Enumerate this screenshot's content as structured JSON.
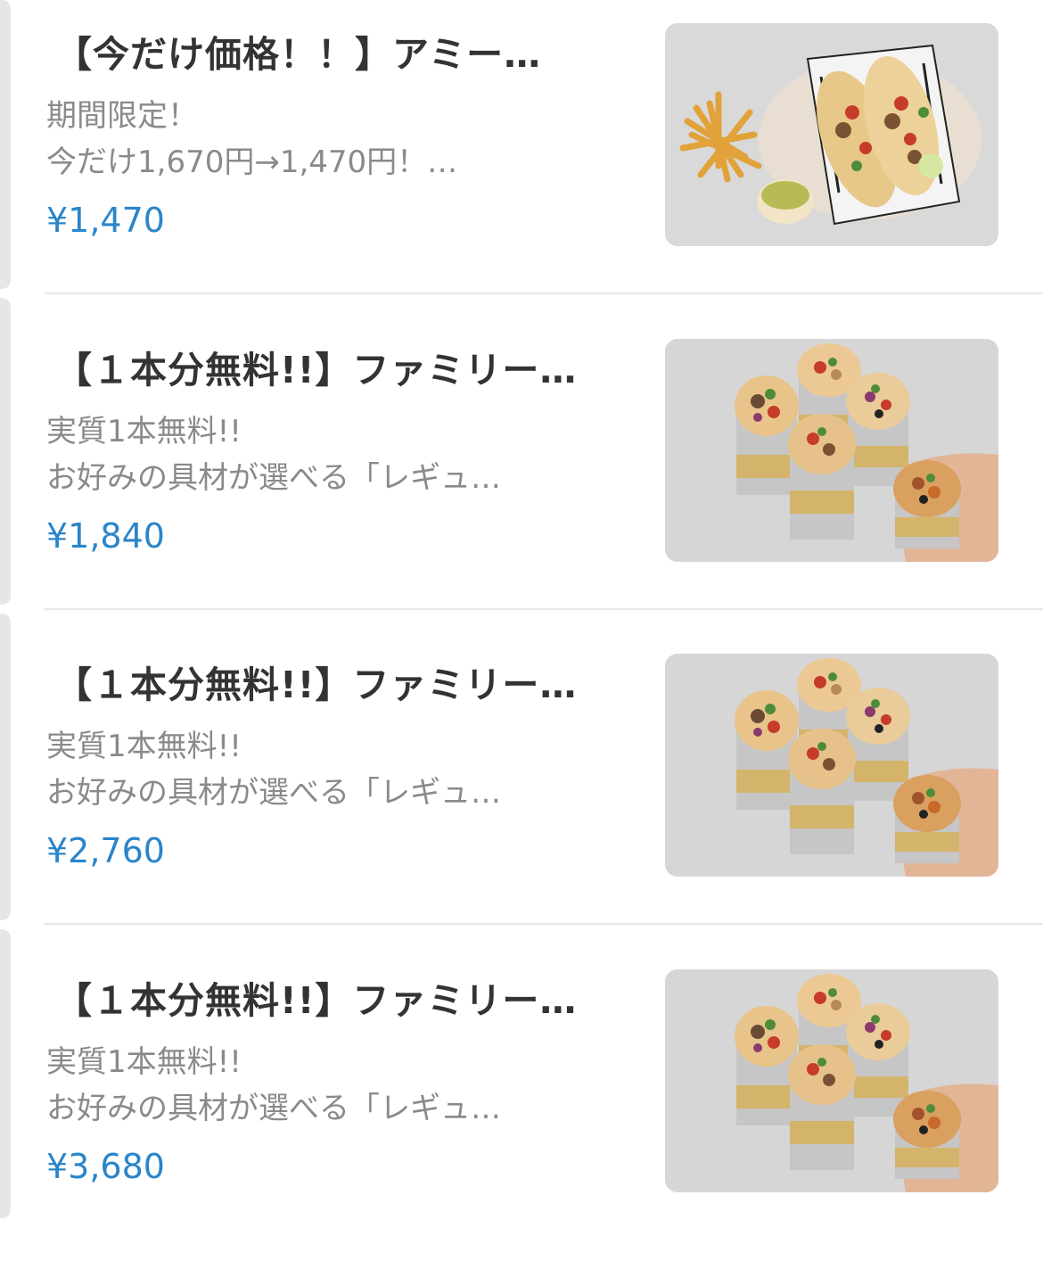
{
  "items": [
    {
      "title": "【今だけ価格！！】アミー…",
      "desc_line1": "期間限定！",
      "desc_line2": "今だけ1,670円→1,470円！…",
      "price": "¥1,470",
      "image": "tacos-fries-guacamole-photo"
    },
    {
      "title": "【１本分無料!!】ファミリー…",
      "desc_line1": "実質1本無料!!",
      "desc_line2": "お好みの具材が選べる「レギュ…",
      "price": "¥1,840",
      "image": "burritos-photo"
    },
    {
      "title": "【１本分無料!!】ファミリー…",
      "desc_line1": "実質1本無料!!",
      "desc_line2": "お好みの具材が選べる「レギュ…",
      "price": "¥2,760",
      "image": "burritos-photo"
    },
    {
      "title": "【１本分無料!!】ファミリー…",
      "desc_line1": "実質1本無料!!",
      "desc_line2": "お好みの具材が選べる「レギュ…",
      "price": "¥3,680",
      "image": "burritos-photo"
    }
  ],
  "colors": {
    "price": "#2a85c9",
    "title": "#333333",
    "desc": "#8a8a8a"
  }
}
